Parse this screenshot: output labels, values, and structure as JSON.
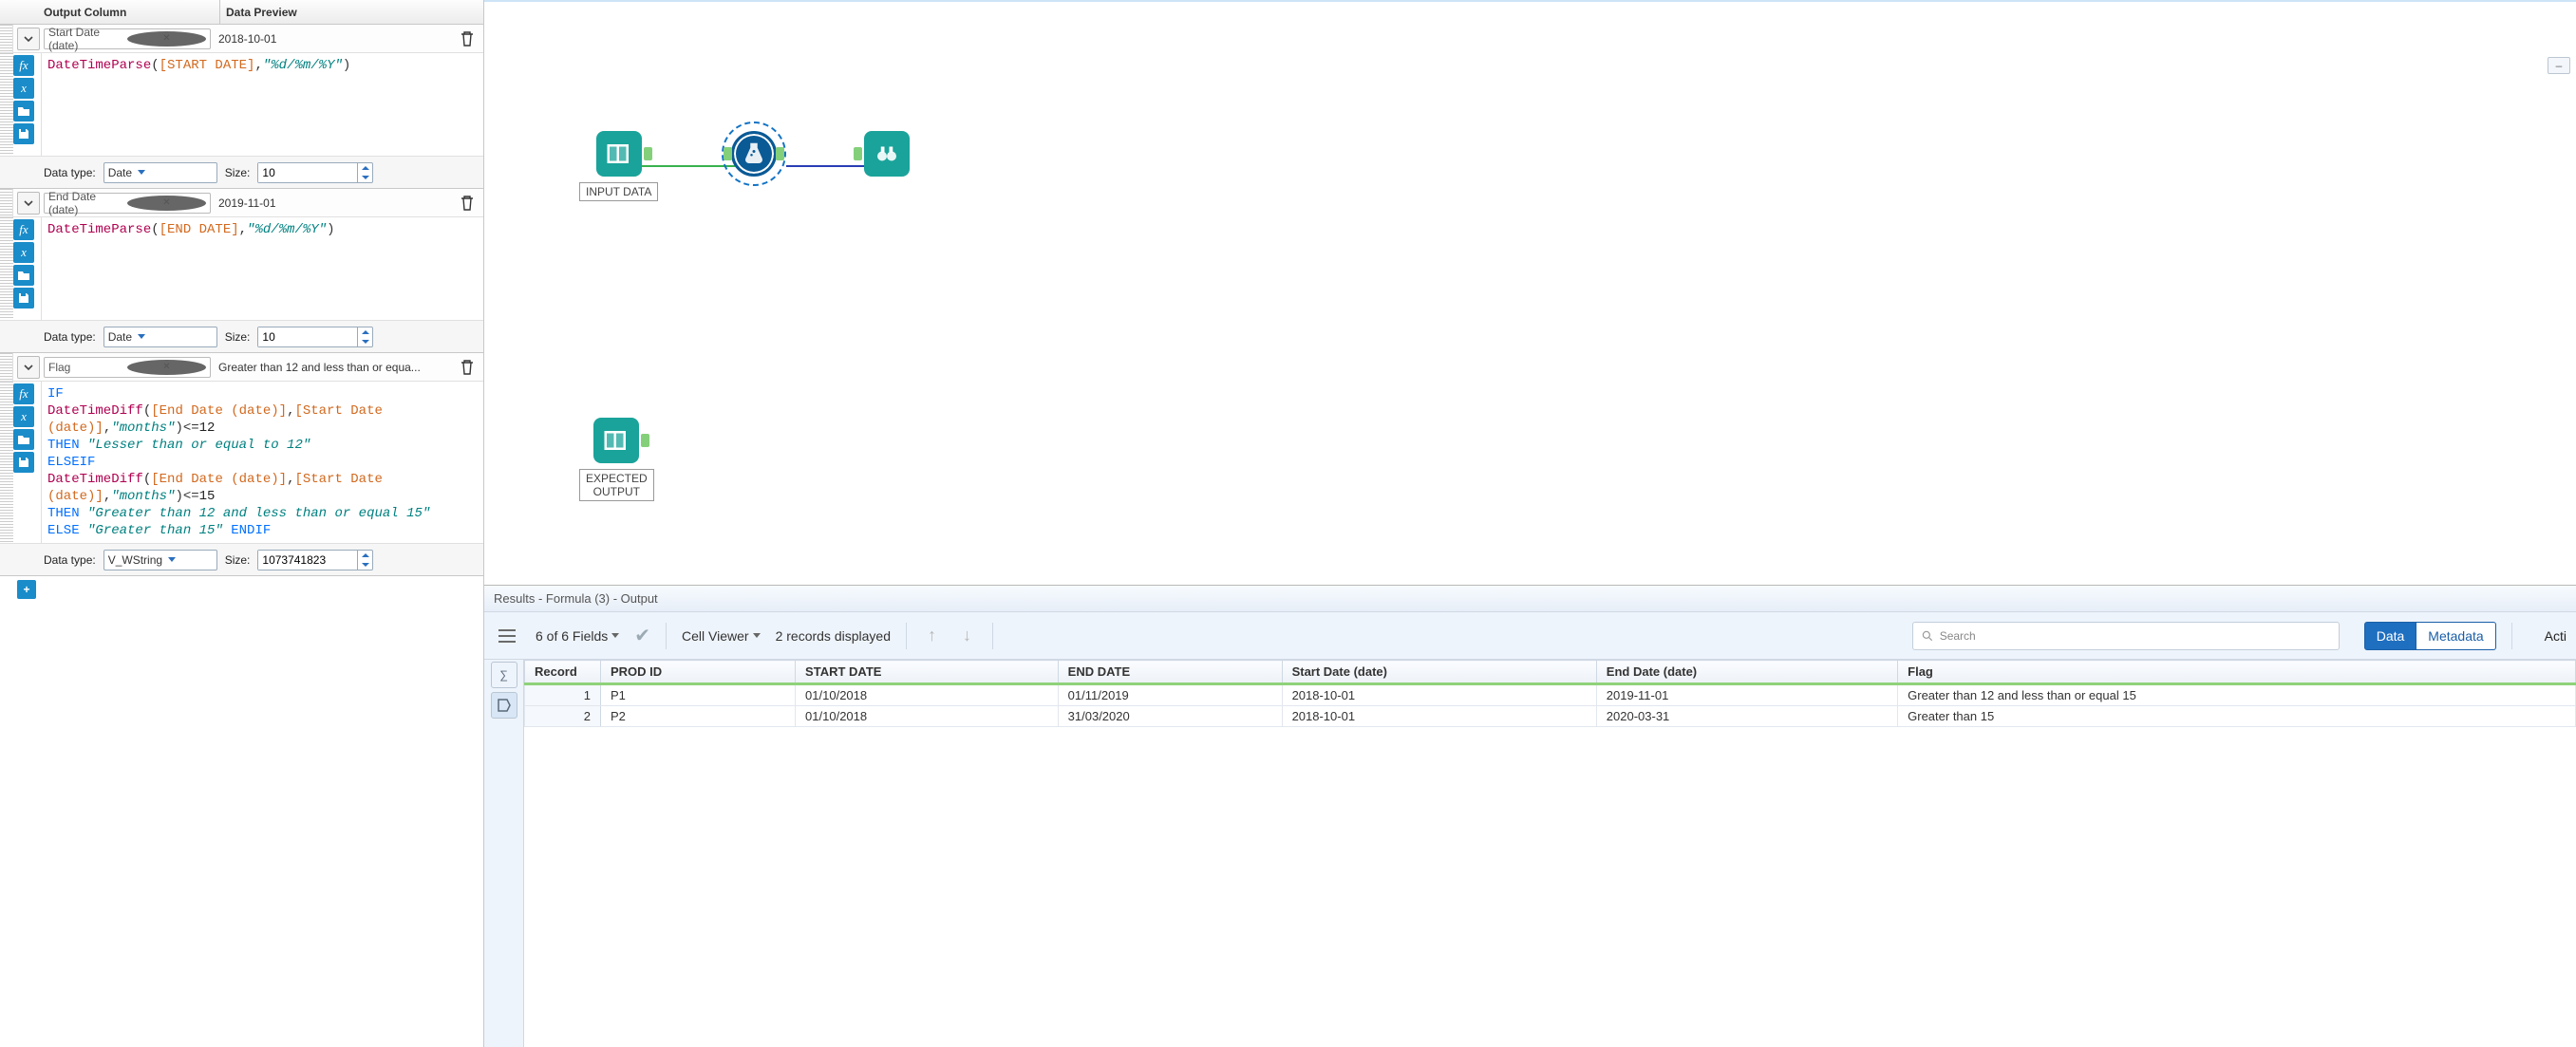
{
  "leftPanel": {
    "headers": {
      "outputColumn": "Output Column",
      "dataPreview": "Data Preview"
    },
    "dataTypeLabel": "Data type:",
    "sizeLabel": "Size:",
    "addTooltip": "+",
    "formulas": [
      {
        "column": "Start Date (date)",
        "preview": "2018-10-01",
        "dataType": "Date",
        "size": "10",
        "tokens": [
          {
            "t": "fn",
            "v": "DateTimeParse"
          },
          {
            "t": "txt",
            "v": "("
          },
          {
            "t": "fld",
            "v": "[START DATE]"
          },
          {
            "t": "txt",
            "v": ","
          },
          {
            "t": "str",
            "v": "\"%d/%m/%Y\""
          },
          {
            "t": "txt",
            "v": ")"
          }
        ]
      },
      {
        "column": "End Date (date)",
        "preview": "2019-11-01",
        "dataType": "Date",
        "size": "10",
        "tokens": [
          {
            "t": "fn",
            "v": "DateTimeParse"
          },
          {
            "t": "txt",
            "v": "("
          },
          {
            "t": "fld",
            "v": "[END DATE]"
          },
          {
            "t": "txt",
            "v": ","
          },
          {
            "t": "str",
            "v": "\"%d/%m/%Y\""
          },
          {
            "t": "txt",
            "v": ")"
          }
        ]
      },
      {
        "column": "Flag",
        "preview": "Greater than 12 and less than or equa...",
        "dataType": "V_WString",
        "size": "1073741823",
        "tokens": [
          {
            "t": "kw",
            "v": "IF"
          },
          {
            "t": "br"
          },
          {
            "t": "fn",
            "v": "DateTimeDiff"
          },
          {
            "t": "txt",
            "v": "("
          },
          {
            "t": "fld",
            "v": "[End Date (date)]"
          },
          {
            "t": "txt",
            "v": ","
          },
          {
            "t": "fld",
            "v": "[Start Date (date)]"
          },
          {
            "t": "txt",
            "v": ","
          },
          {
            "t": "str",
            "v": "\"months\""
          },
          {
            "t": "txt",
            "v": ")<="
          },
          {
            "t": "num",
            "v": "12"
          },
          {
            "t": "br"
          },
          {
            "t": "kw",
            "v": "THEN"
          },
          {
            "t": "txt",
            "v": " "
          },
          {
            "t": "str",
            "v": "\"Lesser than or equal to 12\""
          },
          {
            "t": "br"
          },
          {
            "t": "kw",
            "v": "ELSEIF"
          },
          {
            "t": "br"
          },
          {
            "t": "fn",
            "v": "DateTimeDiff"
          },
          {
            "t": "txt",
            "v": "("
          },
          {
            "t": "fld",
            "v": "[End Date (date)]"
          },
          {
            "t": "txt",
            "v": ","
          },
          {
            "t": "fld",
            "v": "[Start Date (date)]"
          },
          {
            "t": "txt",
            "v": ","
          },
          {
            "t": "str",
            "v": "\"months\""
          },
          {
            "t": "txt",
            "v": ")<="
          },
          {
            "t": "num",
            "v": "15"
          },
          {
            "t": "br"
          },
          {
            "t": "kw",
            "v": "THEN"
          },
          {
            "t": "txt",
            "v": " "
          },
          {
            "t": "str",
            "v": "\"Greater than 12 and less than or equal 15\""
          },
          {
            "t": "br"
          },
          {
            "t": "kw",
            "v": "ELSE"
          },
          {
            "t": "txt",
            "v": " "
          },
          {
            "t": "str",
            "v": "\"Greater than 15\""
          },
          {
            "t": "txt",
            "v": " "
          },
          {
            "t": "kw",
            "v": "ENDIF"
          }
        ]
      }
    ]
  },
  "canvas": {
    "nodes": {
      "input": {
        "label": "INPUT DATA"
      },
      "formula": {
        "label": ""
      },
      "browse": {
        "label": ""
      },
      "expected": {
        "label": "EXPECTED\nOUTPUT"
      }
    }
  },
  "results": {
    "title": "Results - Formula (3) - Output",
    "fieldsSummary": "6 of 6 Fields",
    "cellViewer": "Cell Viewer",
    "recordsText": "2 records displayed",
    "searchPlaceholder": "Search",
    "seg": {
      "data": "Data",
      "metadata": "Metadata"
    },
    "actions": "Acti",
    "columns": [
      "Record",
      "PROD ID",
      "START DATE",
      "END DATE",
      "Start Date (date)",
      "End Date (date)",
      "Flag"
    ],
    "rows": [
      {
        "Record": "1",
        "PROD ID": "P1",
        "START DATE": "01/10/2018",
        "END DATE": "01/11/2019",
        "Start Date (date)": "2018-10-01",
        "End Date (date)": "2019-11-01",
        "Flag": "Greater than 12 and less than or equal 15"
      },
      {
        "Record": "2",
        "PROD ID": "P2",
        "START DATE": "01/10/2018",
        "END DATE": "31/03/2020",
        "Start Date (date)": "2018-10-01",
        "End Date (date)": "2020-03-31",
        "Flag": "Greater than 15"
      }
    ]
  },
  "floatingDash": "–"
}
